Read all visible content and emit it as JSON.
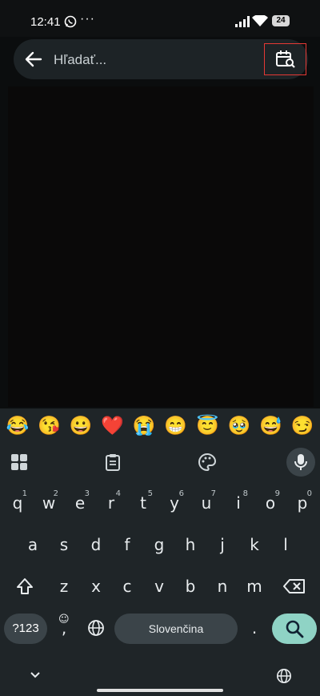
{
  "status": {
    "time": "12:41",
    "battery": "24"
  },
  "search": {
    "placeholder": "Hľadať..."
  },
  "emojis": [
    "😂",
    "😘",
    "😀",
    "❤️",
    "😭",
    "😁",
    "😇",
    "🥹",
    "😅",
    "😏"
  ],
  "keyboard": {
    "row1": [
      {
        "k": "q",
        "h": "1"
      },
      {
        "k": "w",
        "h": "2"
      },
      {
        "k": "e",
        "h": "3"
      },
      {
        "k": "r",
        "h": "4"
      },
      {
        "k": "t",
        "h": "5"
      },
      {
        "k": "y",
        "h": "6"
      },
      {
        "k": "u",
        "h": "7"
      },
      {
        "k": "i",
        "h": "8"
      },
      {
        "k": "o",
        "h": "9"
      },
      {
        "k": "p",
        "h": "0"
      }
    ],
    "row2": [
      "a",
      "s",
      "d",
      "f",
      "g",
      "h",
      "j",
      "k",
      "l"
    ],
    "row3": [
      "z",
      "x",
      "c",
      "v",
      "b",
      "n",
      "m"
    ],
    "num_label": "?123",
    "comma": ",",
    "period": ".",
    "space_label": "Slovenčina"
  }
}
